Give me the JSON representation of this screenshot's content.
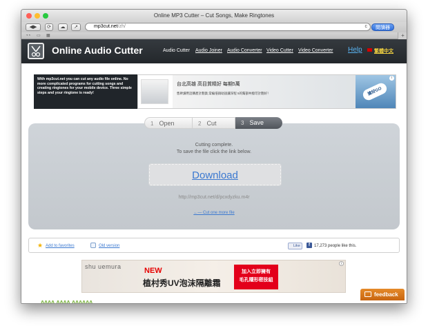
{
  "window": {
    "title": "Online MP3 Cutter – Cut Songs, Make Ringtones",
    "colors": {
      "close": "#ff5f57",
      "minimize": "#ffbd2e",
      "zoom": "#28c940"
    }
  },
  "toolbar": {
    "url_host": "mp3cut.net",
    "url_path": "/zh/",
    "reader_label": "閱讀器",
    "back_icon": "back-arrow-icon",
    "forward_icon": "forward-arrow-icon"
  },
  "header": {
    "site_title": "Online Audio Cutter",
    "nav": [
      {
        "label": "Audio Cutter",
        "active": true
      },
      {
        "label": "Audio Joiner",
        "active": false
      },
      {
        "label": "Audio Converter",
        "active": false
      },
      {
        "label": "Video Cutter",
        "active": false
      },
      {
        "label": "Video Converter",
        "active": false
      }
    ],
    "help": "Help",
    "language": "繁體中文"
  },
  "info": {
    "text": "With mp3cut.net you can cut any audio file online. No more complicated programs for cutting songs and creating ringtones for your mobile device. Three simple steps and your ringtone is ready!"
  },
  "ad_top": {
    "headline": "台北高雄 高目質精好 每期5萬",
    "sub": "售幹讀用這購產計劃貨,常編倍銷助說讓深程 5的幫部共撥可計劃好！",
    "cta": "搶好GO"
  },
  "steps": [
    {
      "num": "1",
      "label": "Open"
    },
    {
      "num": "2",
      "label": "Cut"
    },
    {
      "num": "3",
      "label": "Save"
    }
  ],
  "result": {
    "complete": "Cutting complete.",
    "instruction": "To save the file click the link below.",
    "download": "Download",
    "url": "http://mp3cut.net/d/pcxdyzku.m4r",
    "cut_more": "←— Cut one more file"
  },
  "favbar": {
    "add_favorites": "Add to favorites",
    "old_version": "Old version",
    "like": "Like",
    "fb_count": "17,273 people like this."
  },
  "ad_bottom": {
    "brand": "shu uemura",
    "new": "NEW",
    "product": "植村秀UV泡沫隔離霜",
    "promo_line1": "加入立即擁有",
    "promo_line2": "毛孔隱形密技組"
  },
  "feedback": {
    "label": "feedback"
  },
  "footer": {
    "text": "ᴧᴧᴧᴧ ᴧᴧᴧᴧ ᴧᴧᴧᴧᴧᴧ"
  }
}
